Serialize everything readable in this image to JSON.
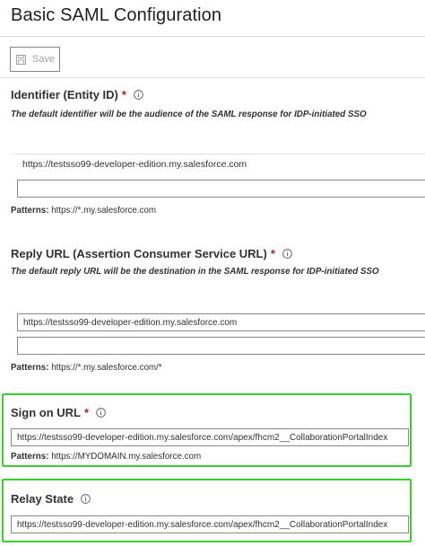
{
  "page": {
    "title": "Basic SAML Configuration"
  },
  "toolbar": {
    "save_label": "Save",
    "save_icon": "save-icon"
  },
  "identifier": {
    "title": "Identifier (Entity ID)",
    "required_mark": "*",
    "description": "The default identifier will be the audience of the SAML response for IDP-initiated SSO",
    "values": [
      "https://testsso99-developer-edition.my.salesforce.com"
    ],
    "empty_input_value": "",
    "patterns_label": "Patterns:",
    "patterns_value": "https://*.my.salesforce.com"
  },
  "reply_url": {
    "title": "Reply URL (Assertion Consumer Service URL)",
    "required_mark": "*",
    "description": "The default reply URL will be the destination in the SAML response for IDP-initiated SSO",
    "values": [
      "https://testsso99-developer-edition.my.salesforce.com"
    ],
    "empty_input_value": "",
    "patterns_label": "Patterns:",
    "patterns_value": "https://*.my.salesforce.com/*"
  },
  "sign_on_url": {
    "title": "Sign on URL",
    "required_mark": "*",
    "value": "https://testsso99-developer-edition.my.salesforce.com/apex/fhcm2__CollaborationPortalIndex",
    "patterns_label": "Patterns:",
    "patterns_value": "https://MYDOMAIN.my.salesforce.com"
  },
  "relay_state": {
    "title": "Relay State",
    "value": "https://testsso99-developer-edition.my.salesforce.com/apex/fhcm2__CollaborationPortalIndex"
  },
  "colors": {
    "highlight": "#39d02e",
    "required": "#a4262c",
    "border": "#8a8886"
  }
}
